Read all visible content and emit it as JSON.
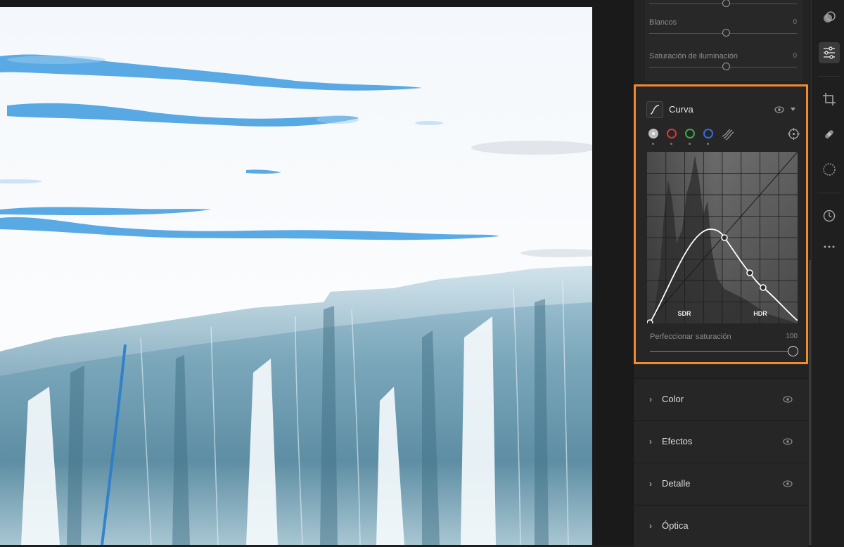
{
  "basic_sliders": [
    {
      "label": "",
      "value": "",
      "position": 0.5
    },
    {
      "label": "Blancos",
      "value": "0",
      "position": 0.5
    },
    {
      "label": "Saturación de iluminación",
      "value": "0",
      "position": 0.5
    }
  ],
  "curve_panel": {
    "title": "Curva",
    "channels": [
      {
        "name": "luminance",
        "color": "#d8d8d8"
      },
      {
        "name": "red",
        "color": "#d23a3a"
      },
      {
        "name": "green",
        "color": "#3aaa45"
      },
      {
        "name": "blue",
        "color": "#3a6ad8"
      }
    ],
    "sdr_label": "SDR",
    "hdr_label": "HDR",
    "saturation_label": "Perfeccionar saturación",
    "saturation_value": "100"
  },
  "sections": [
    {
      "label": "Color"
    },
    {
      "label": "Efectos"
    },
    {
      "label": "Detalle"
    },
    {
      "label": "Óptica"
    }
  ],
  "colors": {
    "highlight_border": "#f28a2e",
    "panel_bg": "#262626"
  }
}
